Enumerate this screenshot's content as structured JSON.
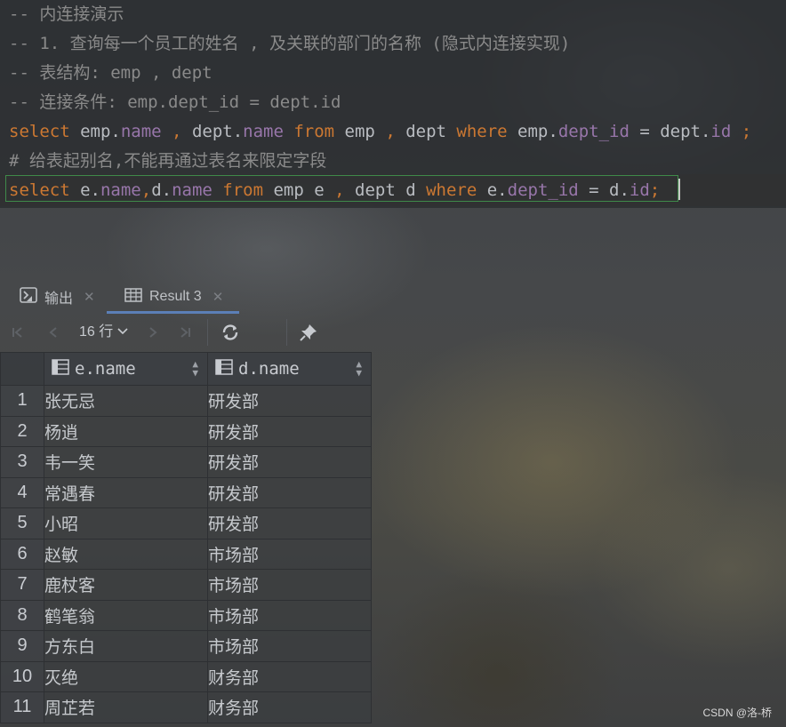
{
  "editor": {
    "lines": [
      {
        "parts": [
          {
            "t": "-- 内连接演示",
            "c": "comment"
          }
        ]
      },
      {
        "parts": [
          {
            "t": "-- 1. 查询每一个员工的姓名 , 及关联的部门的名称 (隐式内连接实现)",
            "c": "comment"
          }
        ]
      },
      {
        "parts": [
          {
            "t": "-- 表结构: emp , dept",
            "c": "comment"
          }
        ]
      },
      {
        "parts": [
          {
            "t": "-- 连接条件: emp.dept_id = dept.id",
            "c": "comment"
          }
        ]
      },
      {
        "parts": [
          {
            "t": "select",
            "c": "kw"
          },
          {
            "t": " emp.",
            "c": "pl"
          },
          {
            "t": "name",
            "c": "fd"
          },
          {
            "t": " , ",
            "c": "kw"
          },
          {
            "t": "dept.",
            "c": "pl"
          },
          {
            "t": "name",
            "c": "fd"
          },
          {
            "t": " from",
            "c": "kw"
          },
          {
            "t": " emp ",
            "c": "pl"
          },
          {
            "t": ",",
            "c": "kw"
          },
          {
            "t": " dept ",
            "c": "pl"
          },
          {
            "t": "where",
            "c": "kw"
          },
          {
            "t": " emp.",
            "c": "pl"
          },
          {
            "t": "dept_id",
            "c": "fd"
          },
          {
            "t": " = dept.",
            "c": "pl"
          },
          {
            "t": "id",
            "c": "fd"
          },
          {
            "t": " ;",
            "c": "kw"
          }
        ]
      },
      {
        "parts": [
          {
            "t": "# 给表起别名,不能再通过表名来限定字段",
            "c": "comment"
          }
        ]
      },
      {
        "parts": [
          {
            "t": "select",
            "c": "kw"
          },
          {
            "t": " e.",
            "c": "pl"
          },
          {
            "t": "name",
            "c": "fd"
          },
          {
            "t": ",",
            "c": "kw"
          },
          {
            "t": "d.",
            "c": "pl"
          },
          {
            "t": "name",
            "c": "fd"
          },
          {
            "t": " from",
            "c": "kw"
          },
          {
            "t": " emp e ",
            "c": "pl"
          },
          {
            "t": ",",
            "c": "kw"
          },
          {
            "t": " dept d ",
            "c": "pl"
          },
          {
            "t": "where",
            "c": "kw"
          },
          {
            "t": " e.",
            "c": "pl"
          },
          {
            "t": "dept_id",
            "c": "fd"
          },
          {
            "t": " = d.",
            "c": "pl"
          },
          {
            "t": "id",
            "c": "fd"
          },
          {
            "t": ";",
            "c": "kw"
          }
        ]
      }
    ]
  },
  "tabs": {
    "output_label": "输出",
    "result_label": "Result 3",
    "close_glyph": "✕"
  },
  "toolbar": {
    "rows_label": "16 行"
  },
  "table": {
    "columns": [
      "e.name",
      "d.name"
    ],
    "rows": [
      [
        "1",
        "张无忌",
        "研发部"
      ],
      [
        "2",
        "杨逍",
        "研发部"
      ],
      [
        "3",
        "韦一笑",
        "研发部"
      ],
      [
        "4",
        "常遇春",
        "研发部"
      ],
      [
        "5",
        "小昭",
        "研发部"
      ],
      [
        "6",
        "赵敏",
        "市场部"
      ],
      [
        "7",
        "鹿杖客",
        "市场部"
      ],
      [
        "8",
        "鹤笔翁",
        "市场部"
      ],
      [
        "9",
        "方东白",
        "市场部"
      ],
      [
        "10",
        "灭绝",
        "财务部"
      ],
      [
        "11",
        "周芷若",
        "财务部"
      ]
    ]
  },
  "watermark": "CSDN @洛-桥",
  "colors": {
    "keyword": "#cc7832",
    "field": "#9876aa",
    "comment": "#8a8a8a",
    "active_tab": "#5b7fb7",
    "statement_border": "#3f8a4a"
  }
}
